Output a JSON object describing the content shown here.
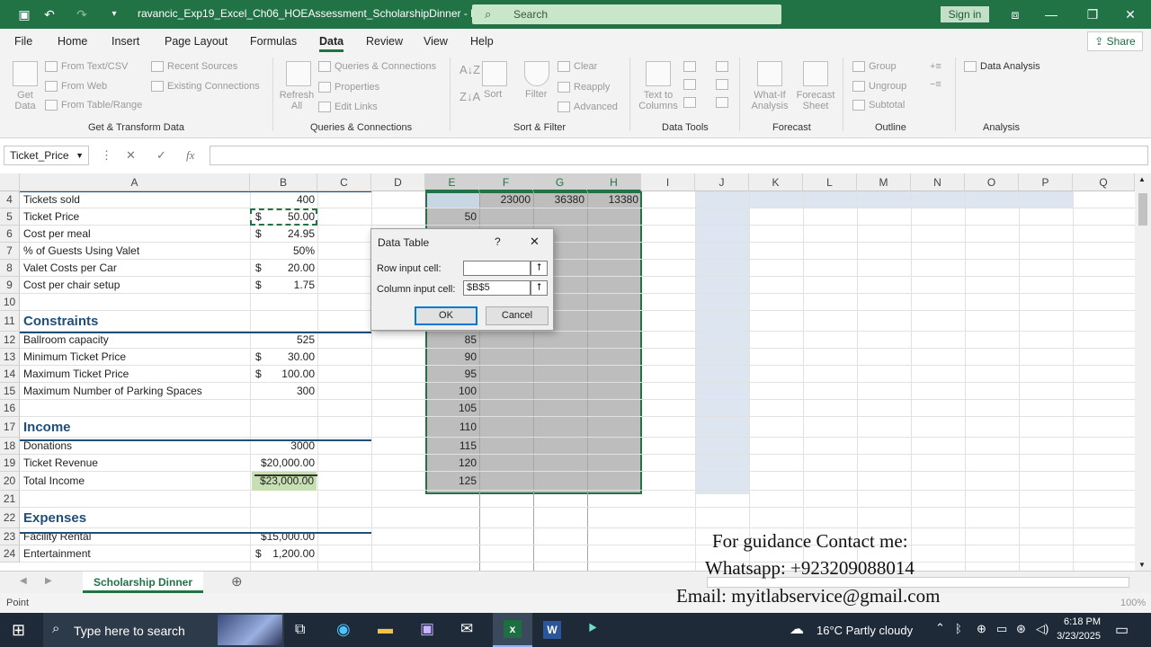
{
  "titlebar": {
    "filename": "ravancic_Exp19_Excel_Ch06_HOEAssessment_ScholarshipDinner  -  Excel",
    "search_placeholder": "Search",
    "signin": "Sign in"
  },
  "menu": {
    "items": [
      "File",
      "Home",
      "Insert",
      "Page Layout",
      "Formulas",
      "Data",
      "Review",
      "View",
      "Help"
    ],
    "active": "Data",
    "share": "Share"
  },
  "ribbon": {
    "get_data": "Get Data",
    "from_text": "From Text/CSV",
    "from_web": "From Web",
    "from_table": "From Table/Range",
    "recent_sources": "Recent Sources",
    "existing_connections": "Existing Connections",
    "group_get_transform": "Get & Transform Data",
    "refresh_all": "Refresh All",
    "queries_connections": "Queries & Connections",
    "properties": "Properties",
    "edit_links": "Edit Links",
    "group_queries": "Queries & Connections",
    "sort": "Sort",
    "filter": "Filter",
    "clear": "Clear",
    "reapply": "Reapply",
    "advanced": "Advanced",
    "group_sort_filter": "Sort & Filter",
    "text_to_columns": "Text to Columns",
    "group_data_tools": "Data Tools",
    "what_if": "What-If Analysis",
    "forecast_sheet": "Forecast Sheet",
    "group_forecast": "Forecast",
    "group": "Group",
    "ungroup": "Ungroup",
    "subtotal": "Subtotal",
    "group_outline": "Outline",
    "data_analysis": "Data Analysis",
    "group_analysis": "Analysis"
  },
  "formula_bar": {
    "name_box": "Ticket_Price",
    "formula": ""
  },
  "columns": [
    "A",
    "B",
    "C",
    "D",
    "E",
    "F",
    "G",
    "H",
    "I",
    "J",
    "K",
    "L",
    "M",
    "N",
    "O",
    "P",
    "Q"
  ],
  "rows": [
    {
      "num": "4",
      "a": "Tickets sold",
      "b": "400",
      "e": "",
      "f": "23000",
      "g": "36380",
      "h": "13380"
    },
    {
      "num": "5",
      "a": "Ticket Price",
      "b_cur": "$",
      "b": "50.00",
      "e": "50"
    },
    {
      "num": "6",
      "a": "Cost per meal",
      "b_cur": "$",
      "b": "24.95"
    },
    {
      "num": "7",
      "a": "% of Guests Using Valet",
      "b": "50%"
    },
    {
      "num": "8",
      "a": "Valet Costs per Car",
      "b_cur": "$",
      "b": "20.00"
    },
    {
      "num": "9",
      "a": "Cost per chair setup",
      "b_cur": "$",
      "b": "1.75"
    },
    {
      "num": "10",
      "a": "",
      "b": ""
    },
    {
      "num": "11",
      "a": "Constraints",
      "b": ""
    },
    {
      "num": "12",
      "a": "Ballroom capacity",
      "b": "525"
    },
    {
      "num": "13",
      "a": "Minimum Ticket Price",
      "b_cur": "$",
      "b": "30.00",
      "e": "90"
    },
    {
      "num": "14",
      "a": "Maximum Ticket Price",
      "b_cur": "$",
      "b": "100.00",
      "e": "95"
    },
    {
      "num": "15",
      "a": "Maximum Number of Parking Spaces",
      "b": "300",
      "e": "100"
    },
    {
      "num": "16",
      "a": "",
      "b": "",
      "e": "105"
    },
    {
      "num": "17",
      "a": "Income",
      "b": "",
      "e": "110"
    },
    {
      "num": "18",
      "a": "Donations",
      "b": "3000",
      "e": "115"
    },
    {
      "num": "19",
      "a": "Ticket Revenue",
      "b": "$20,000.00",
      "e": "120"
    },
    {
      "num": "20",
      "a": "Total Income",
      "b": "$23,000.00",
      "e": "125"
    },
    {
      "num": "21",
      "a": "",
      "b": ""
    },
    {
      "num": "22",
      "a": "Expenses",
      "b": ""
    },
    {
      "num": "23",
      "a": "Facility Rental",
      "b": "$15,000.00"
    },
    {
      "num": "24",
      "a": "Entertainment",
      "b_cur": "$",
      "b": "1,200.00"
    }
  ],
  "e_row12": "85",
  "dialog": {
    "title": "Data Table",
    "help": "?",
    "close": "✕",
    "row_label": "Row input cell:",
    "row_value": "",
    "col_label": "Column input cell:",
    "col_value": "$B$5",
    "ok": "OK",
    "cancel": "Cancel"
  },
  "sheet_tab": "Scholarship Dinner",
  "status": {
    "mode": "Point",
    "zoom": "100%"
  },
  "watermark": {
    "line1": "For guidance Contact me:",
    "line2": "Whatsapp: +923209088014",
    "line3": "Email: myitlabservice@gmail.com"
  },
  "taskbar": {
    "search": "Type here to search",
    "weather": "16°C  Partly cloudy",
    "time": "6:18 PM",
    "date": "3/23/2025"
  }
}
